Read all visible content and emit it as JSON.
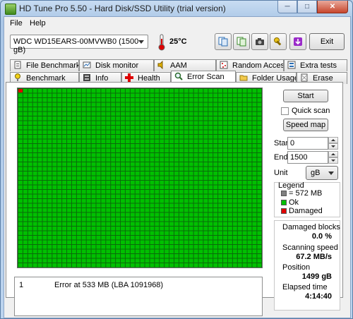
{
  "window": {
    "title": "HD Tune Pro 5.50 - Hard Disk/SSD Utility (trial version)"
  },
  "menu": {
    "file": "File",
    "help": "Help"
  },
  "toolbar": {
    "drive": "WDC WD15EARS-00MVWB0 (1500 gB)",
    "temperature": "25°C",
    "exit_label": "Exit"
  },
  "tabs_top": [
    "File Benchmark",
    "Disk monitor",
    "AAM",
    "Random Access",
    "Extra tests"
  ],
  "tabs_bottom": [
    "Benchmark",
    "Info",
    "Health",
    "Error Scan",
    "Folder Usage",
    "Erase"
  ],
  "active_tab": "Error Scan",
  "scan": {
    "start_label": "Start",
    "quick_scan_label": "Quick scan",
    "speed_map_label": "Speed map",
    "start_field_label": "Start",
    "start_value": "0",
    "end_field_label": "End",
    "end_value": "1500",
    "unit_label": "Unit",
    "unit_value": "gB"
  },
  "legend": {
    "title": "Legend",
    "block_size": "= 572 MB",
    "ok": "Ok",
    "damaged": "Damaged",
    "colors": {
      "block": "#808080",
      "ok": "#00c000",
      "damaged": "#e00000"
    }
  },
  "stats": {
    "damaged_blocks_label": "Damaged blocks",
    "damaged_blocks_value": "0.0 %",
    "scanning_speed_label": "Scanning speed",
    "scanning_speed_value": "67.2 MB/s",
    "position_label": "Position",
    "position_value": "1499 gB",
    "elapsed_time_label": "Elapsed time",
    "elapsed_time_value": "4:14:40"
  },
  "log": [
    {
      "num": "1",
      "message": "Error at 533 MB (LBA 1091968)"
    }
  ]
}
